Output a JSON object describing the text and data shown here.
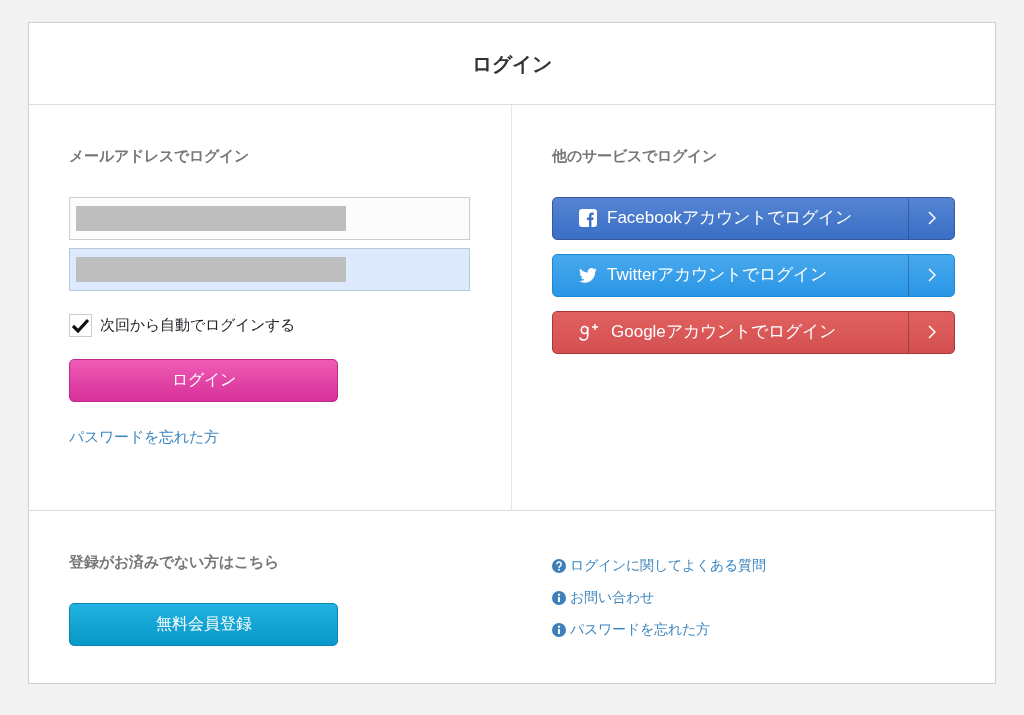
{
  "title": "ログイン",
  "email_login": {
    "heading": "メールアドレスでログイン",
    "fields": [
      {
        "autofilled": false
      },
      {
        "autofilled": true
      }
    ],
    "remember": {
      "label": "次回から自動でログインする",
      "checked": true
    },
    "login_button": "ログイン",
    "forgot_link": "パスワードを忘れた方"
  },
  "social_login": {
    "heading": "他のサービスでログイン",
    "buttons": [
      {
        "kind": "facebook",
        "label": "Facebookアカウントでログイン"
      },
      {
        "kind": "twitter",
        "label": "Twitterアカウントでログイン"
      },
      {
        "kind": "google",
        "label": "Googleアカウントでログイン"
      }
    ]
  },
  "register": {
    "heading": "登録がお済みでない方はこちら",
    "button": "無料会員登録"
  },
  "help_links": [
    {
      "kind": "question",
      "label": "ログインに関してよくある質問"
    },
    {
      "kind": "info",
      "label": "お問い合わせ"
    },
    {
      "kind": "info",
      "label": "パスワードを忘れた方"
    }
  ]
}
